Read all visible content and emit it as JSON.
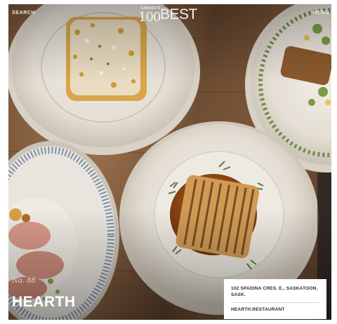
{
  "header": {
    "search_label": "SEARCH",
    "menu_label": "MENU",
    "logo": {
      "small": "CANADA'S",
      "number": "100",
      "word": "BEST"
    }
  },
  "restaurant": {
    "rank": "No. 88",
    "name": "HEARTH",
    "address": "102 SPADINA CRES. E., SASKATOON, SASK.",
    "website": "HEARTH.RESTAURANT"
  },
  "colors": {
    "table_wood": "#7a573a",
    "plate": "#ece8e1",
    "card_bg": "#ffffff",
    "text_light": "#f2ede6"
  }
}
